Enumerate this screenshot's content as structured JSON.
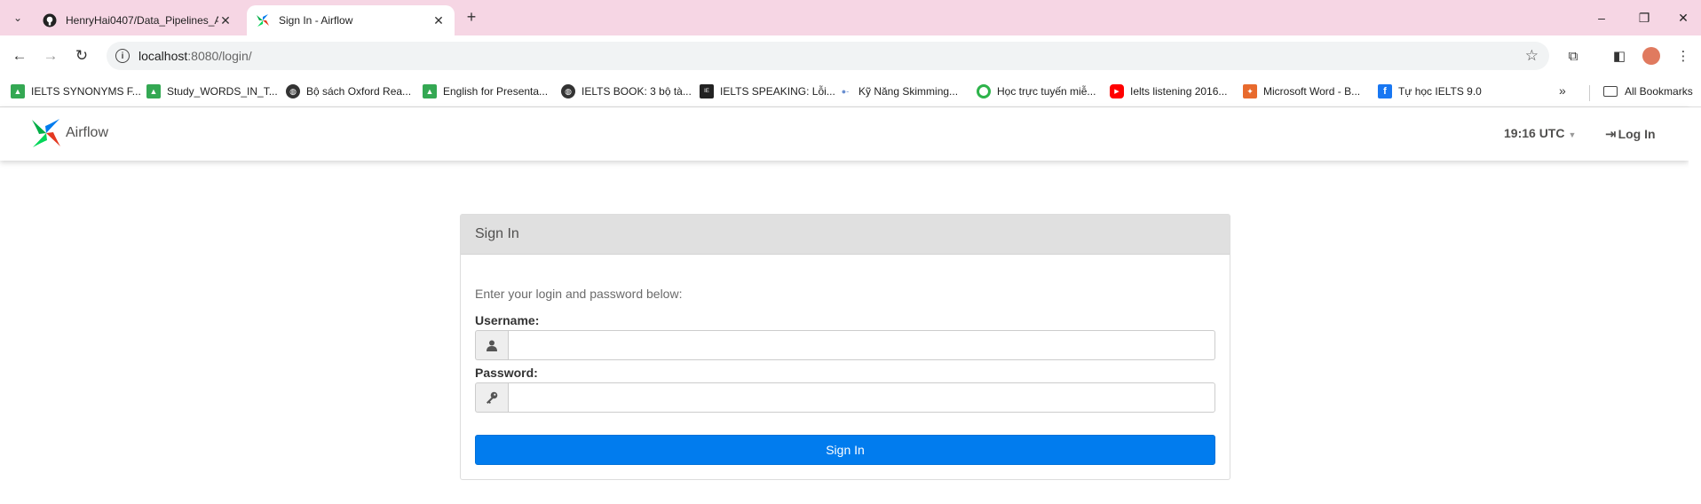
{
  "browser": {
    "tabs": [
      {
        "title": "HenryHai0407/Data_Pipelines_A",
        "icon": "github-icon"
      },
      {
        "title": "Sign In - Airflow",
        "icon": "airflow-icon",
        "active": true
      }
    ],
    "new_tab": "+",
    "window_controls": [
      "–",
      "❐",
      "✕"
    ],
    "address": {
      "host": "localhost",
      "rest": ":8080/login/"
    },
    "bookmarks": [
      {
        "label": "IELTS SYNONYMS F...",
        "icon": "google-drive-icon"
      },
      {
        "label": "Study_WORDS_IN_T...",
        "icon": "google-drive-icon"
      },
      {
        "label": "Bộ sách Oxford Rea...",
        "icon": "globe-icon"
      },
      {
        "label": "English for Presenta...",
        "icon": "google-drive-icon"
      },
      {
        "label": "IELTS BOOK: 3 bộ tà...",
        "icon": "globe-icon"
      },
      {
        "label": "IELTS SPEAKING: Lỗi...",
        "icon": "ielts-icon"
      },
      {
        "label": "Kỹ Năng Skimming...",
        "icon": "site-icon"
      },
      {
        "label": "Học trực tuyến miễ...",
        "icon": "green-circle-icon"
      },
      {
        "label": "Ielts listening 2016...",
        "icon": "youtube-icon"
      },
      {
        "label": "Microsoft Word - B...",
        "icon": "word-icon"
      },
      {
        "label": "Tự học IELTS 9.0",
        "icon": "facebook-icon"
      }
    ],
    "bookmarks_more": "»",
    "all_bookmarks": "All Bookmarks"
  },
  "navbar": {
    "brand": "Airflow",
    "clock": "19:16 UTC",
    "login": "Log In"
  },
  "login_panel": {
    "title": "Sign In",
    "hint": "Enter your login and password below:",
    "username_label": "Username:",
    "username_value": "",
    "password_label": "Password:",
    "password_value": "",
    "submit": "Sign In"
  },
  "colors": {
    "chrome_bg": "#f6d6e4",
    "primary_button": "#017cee",
    "panel_header": "#e0e0e0"
  }
}
